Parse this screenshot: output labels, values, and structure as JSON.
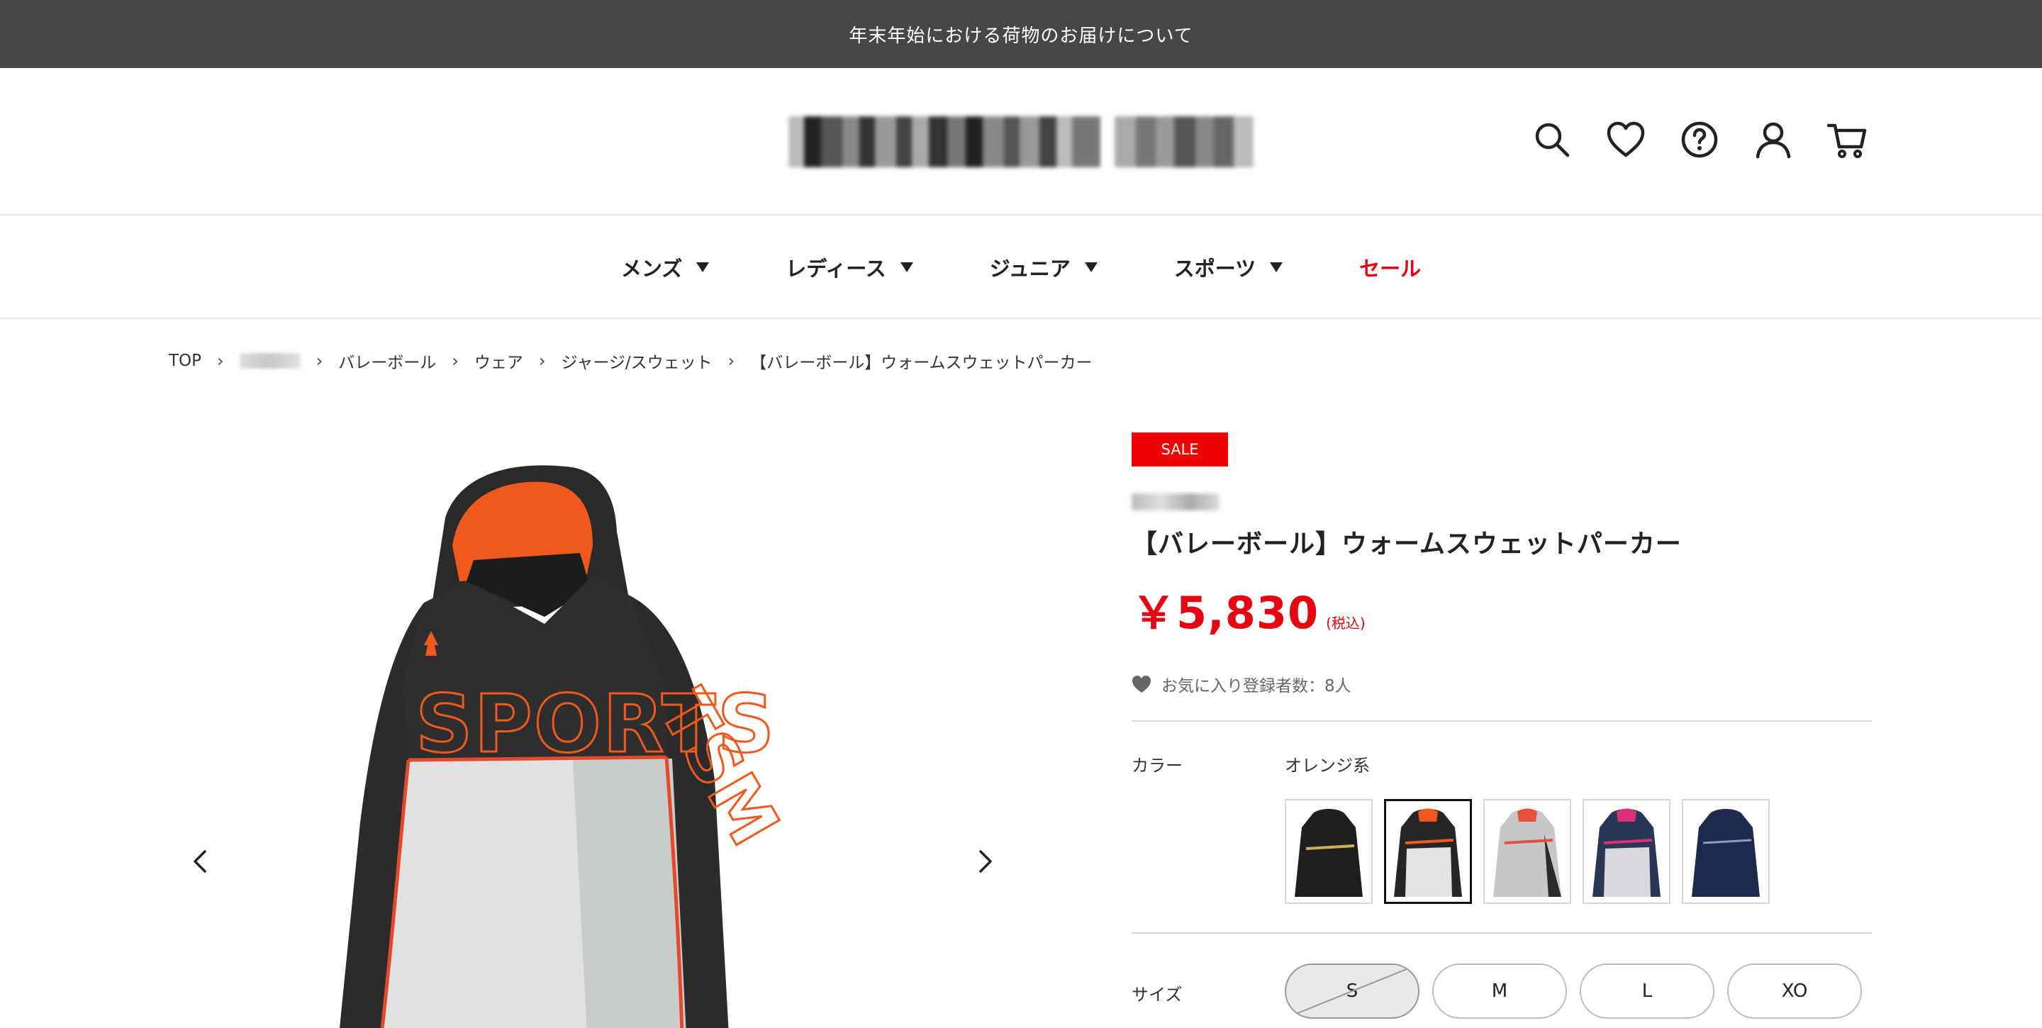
{
  "announcement": "年末年始における荷物のお届けについて",
  "header": {
    "icons": [
      "search-icon",
      "heart-icon",
      "help-icon",
      "account-icon",
      "cart-icon"
    ]
  },
  "nav": {
    "items": [
      {
        "label": "メンズ"
      },
      {
        "label": "レディース"
      },
      {
        "label": "ジュニア"
      },
      {
        "label": "スポーツ"
      },
      {
        "label": "セール"
      }
    ]
  },
  "breadcrumb": {
    "items": [
      "TOP",
      "バレーボール",
      "ウェア",
      "ジャージ/スウェット",
      "【バレーボール】ウォームスウェットパーカー"
    ]
  },
  "product": {
    "sale_badge": "SALE",
    "title": "【バレーボール】ウォームスウェットパーカー",
    "price": "￥5,830",
    "tax": "(税込)",
    "favorites": "お気に入り登録者数：8人",
    "color_label": "カラー",
    "color_value": "オレンジ系",
    "size_label": "サイズ",
    "sizes": [
      "S",
      "M",
      "L",
      "XO"
    ]
  },
  "colors": {
    "sale": "#f00000",
    "price": "#e60012",
    "announcement_bg": "#474747"
  }
}
